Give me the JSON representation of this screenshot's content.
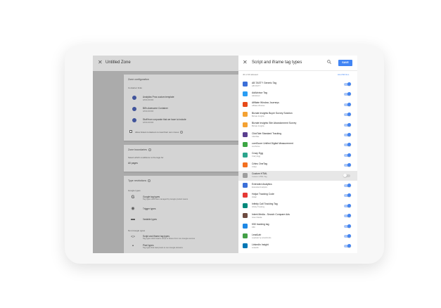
{
  "left_panel": {
    "title": "Untitled Zone",
    "zone_configuration": {
      "title": "Zone configuration",
      "subtitle": "Container links",
      "items": [
        {
          "label": "Analytics Pros custom template",
          "sub": "GTM-XXXXX"
        },
        {
          "label": "Bill's Awesome Container",
          "sub": "GTM-XXXXX"
        },
        {
          "label": "Stuff from corporate that we have to include",
          "sub": "GTM-XXXXX"
        }
      ],
      "checkbox_label": "Allow linked containers to load their own zones"
    },
    "zone_boundaries": {
      "title": "Zone boundaries",
      "description": "Select which conditions to fire tags for",
      "value": "All pages"
    },
    "type_restrictions": {
      "title": "Type restrictions",
      "google_types_label": "Google types",
      "google_items": [
        {
          "label": "Google tag types",
          "sub": "Tag types which are managed by Google product teams"
        },
        {
          "label": "Trigger types",
          "sub": ""
        },
        {
          "label": "Variable types",
          "sub": ""
        }
      ],
      "non_google_label": "Non-Google types",
      "non_google_items": [
        {
          "label": "Script and iframe tag types",
          "sub": "Tag types which load a script or iframe from non-Google sources"
        },
        {
          "label": "Pixel types",
          "sub": "Tag types that load pixels to non-Google domains"
        }
      ]
    }
  },
  "right_panel": {
    "title": "Script and iframe tag types",
    "save_label": "SAVE",
    "count_text": "40 of 40 allowed",
    "allow_all_label": "ALLOW ALL",
    "items": [
      {
        "name": "AB TASTY Generic Tag",
        "vendor": "AB TASTY",
        "color": "#3b6fd8",
        "on": true
      },
      {
        "name": "AdAdvisor Tag",
        "vendor": "AdAdvisor",
        "color": "#2a9df4",
        "on": true
      },
      {
        "name": "Affiliate Window Journeys",
        "vendor": "Affiliate Window",
        "color": "#e64a19",
        "on": true
      },
      {
        "name": "Bizrate Insights Buyer Survey Solution",
        "vendor": "Bizrate Insights",
        "color": "#f4a233",
        "on": true
      },
      {
        "name": "Bizrate Insights Site Abandonment Survey",
        "vendor": "Bizrate Insights",
        "color": "#f4a233",
        "on": true
      },
      {
        "name": "ClickTale Standard Tracking",
        "vendor": "ClickTale",
        "color": "#5b3f8f",
        "on": true
      },
      {
        "name": "comScore Unified Digital Measurement",
        "vendor": "comScore",
        "color": "#3da644",
        "on": true
      },
      {
        "name": "Crazy Egg",
        "vendor": "Crazy Egg",
        "color": "#2ca58d",
        "on": true
      },
      {
        "name": "Criteo OneTag",
        "vendor": "Criteo",
        "color": "#f37021",
        "on": true
      },
      {
        "name": "Custom HTML",
        "vendor": "Custom HTML Tag",
        "color": "#9e9e9e",
        "on": false
      },
      {
        "name": "Extended Analytics",
        "vendor": "Extended Analytics",
        "color": "#3b6fd8",
        "on": true
      },
      {
        "name": "Hotjar Tracking Code",
        "vendor": "Hotjar",
        "color": "#e53935",
        "on": true
      },
      {
        "name": "Infinity Call Tracking Tag",
        "vendor": "Infinity Tracking",
        "color": "#00897b",
        "on": true
      },
      {
        "name": "Intent Media - Search Compare Ads",
        "vendor": "Intent Media",
        "color": "#6d4c41",
        "on": true
      },
      {
        "name": "K50 tracking tag",
        "vendor": "K50",
        "color": "#1e88e5",
        "on": true
      },
      {
        "name": "LeadLab",
        "vendor": "LeadLab by wiredminds",
        "color": "#43a047",
        "on": true
      },
      {
        "name": "LinkedIn Insight",
        "vendor": "LinkedIn",
        "color": "#0077b5",
        "on": true
      }
    ]
  }
}
